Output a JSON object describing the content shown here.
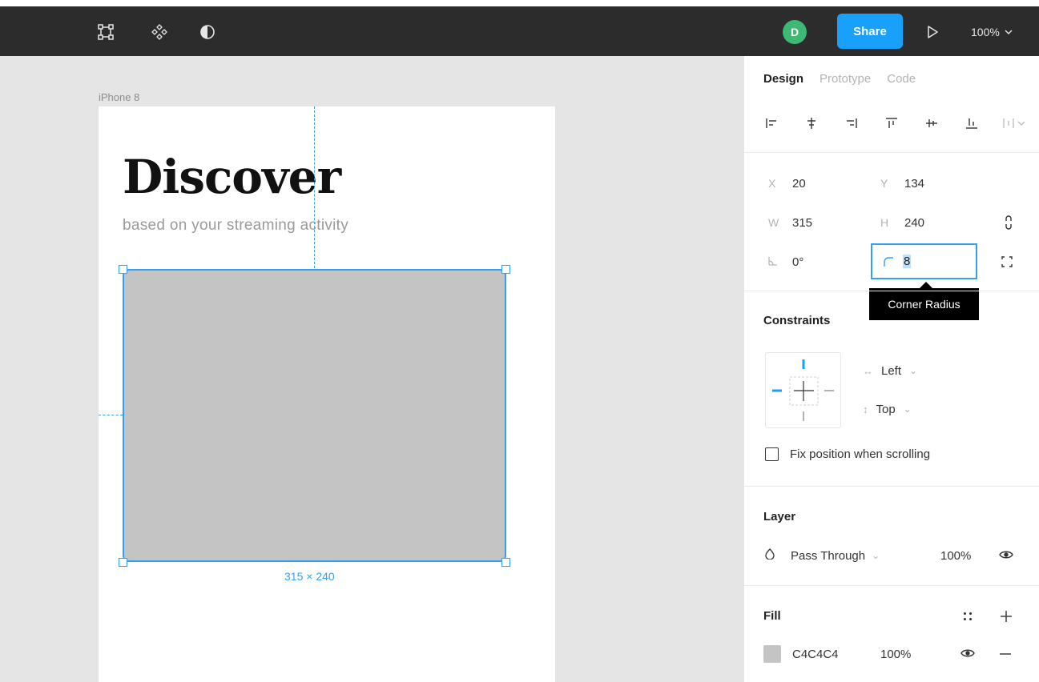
{
  "toolbar": {
    "icons": [
      "frame-tool-icon",
      "components-icon",
      "theme-contrast-icon"
    ],
    "avatar_initial": "D",
    "avatar_color": "#3cba74",
    "share_label": "Share",
    "share_color": "#18a0fb",
    "play_icon": "play-icon",
    "zoom_label": "100%"
  },
  "canvas": {
    "frame_name": "iPhone 8",
    "heading": "Discover",
    "subheading": "based on your streaming activity",
    "selection_dimensions": "315 × 240",
    "selection_color": "#35a0f0",
    "rect_fill": "#c4c4c4"
  },
  "panel": {
    "tabs": [
      {
        "label": "Design",
        "active": true
      },
      {
        "label": "Prototype",
        "active": false
      },
      {
        "label": "Code",
        "active": false
      }
    ],
    "align_icons": [
      "align-left-icon",
      "align-horizontal-center-icon",
      "align-right-icon",
      "align-top-icon",
      "align-vertical-center-icon",
      "align-bottom-icon",
      "distribute-icon"
    ],
    "properties": {
      "x_label": "X",
      "x_value": "20",
      "y_label": "Y",
      "y_value": "134",
      "w_label": "W",
      "w_value": "315",
      "h_label": "H",
      "h_value": "240",
      "rotation_value": "0°",
      "corner_radius_value": "8",
      "corner_radius_tooltip": "Corner Radius"
    },
    "constraints": {
      "title": "Constraints",
      "horizontal": "Left",
      "vertical": "Top",
      "fix_position_label": "Fix position when scrolling"
    },
    "layer": {
      "title": "Layer",
      "blend_mode": "Pass Through",
      "opacity": "100%"
    },
    "fill": {
      "title": "Fill",
      "hex": "C4C4C4",
      "opacity": "100%",
      "swatch_color": "#c4c4c4"
    }
  }
}
